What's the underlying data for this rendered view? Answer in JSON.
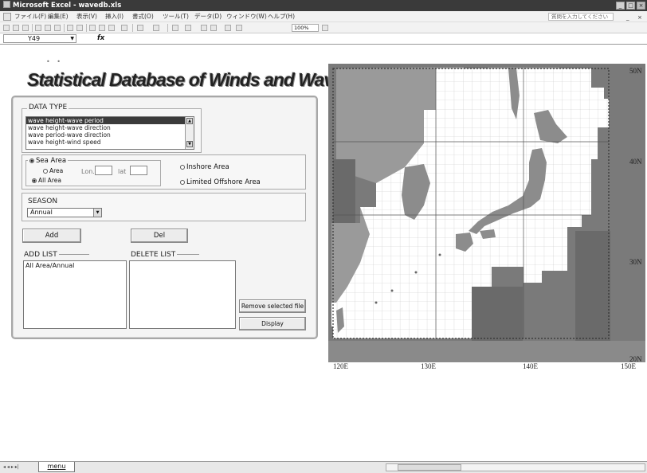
{
  "window": {
    "title": "Microsoft Excel - wavedb.xls",
    "btn_min": "_",
    "btn_max": "□",
    "btn_close": "×"
  },
  "menu": {
    "items": [
      "ファイル(F)",
      "編集(E)",
      "表示(V)",
      "挿入(I)",
      "書式(O)",
      "ツール(T)",
      "データ(D)",
      "ウィンドウ(W)",
      "ヘルプ(H)"
    ],
    "help_placeholder": "質問を入力してください",
    "doc_min": "_",
    "doc_close": "×"
  },
  "toolbar": {
    "zoom": "100%"
  },
  "formula": {
    "name_box": "Y49",
    "fx": "fx"
  },
  "app": {
    "logo_dots": "• •",
    "title": "Statistical Database of Winds and Waves around Japan"
  },
  "data_type": {
    "label": "DATA TYPE",
    "options": [
      "wave height-wave period",
      "wave height-wave direction",
      "wave period-wave direction",
      "wave height-wind speed"
    ],
    "selected_index": 0
  },
  "area": {
    "sea_area": "Sea Area",
    "area": "Area",
    "lon": "Lon.",
    "lat": "lat",
    "all_area": "All Area",
    "inshore": "Inshore Area",
    "limited_offshore": "Limited Offshore Area",
    "selected": "all_area"
  },
  "season": {
    "label": "SEASON",
    "value": "Annual"
  },
  "buttons": {
    "add": "Add",
    "del": "Del",
    "remove_selected": "Remove selected file",
    "display": "Display"
  },
  "lists": {
    "add_title": "ADD LIST",
    "add_items": [
      "All Area/Annual"
    ],
    "delete_title": "DELETE LIST",
    "delete_items": []
  },
  "map": {
    "lat_labels": [
      "50N",
      "40N",
      "30N",
      "20N"
    ],
    "lon_labels": [
      "120E",
      "130E",
      "140E",
      "150E"
    ],
    "colors": {
      "land": "#8c8c8c",
      "outside": "#6e6e6e",
      "grid": "#bdbdbd",
      "sea": "#ffffff"
    }
  },
  "sheets": {
    "nav": "◂ ◂ ▸ ▸|",
    "tab": "menu"
  }
}
